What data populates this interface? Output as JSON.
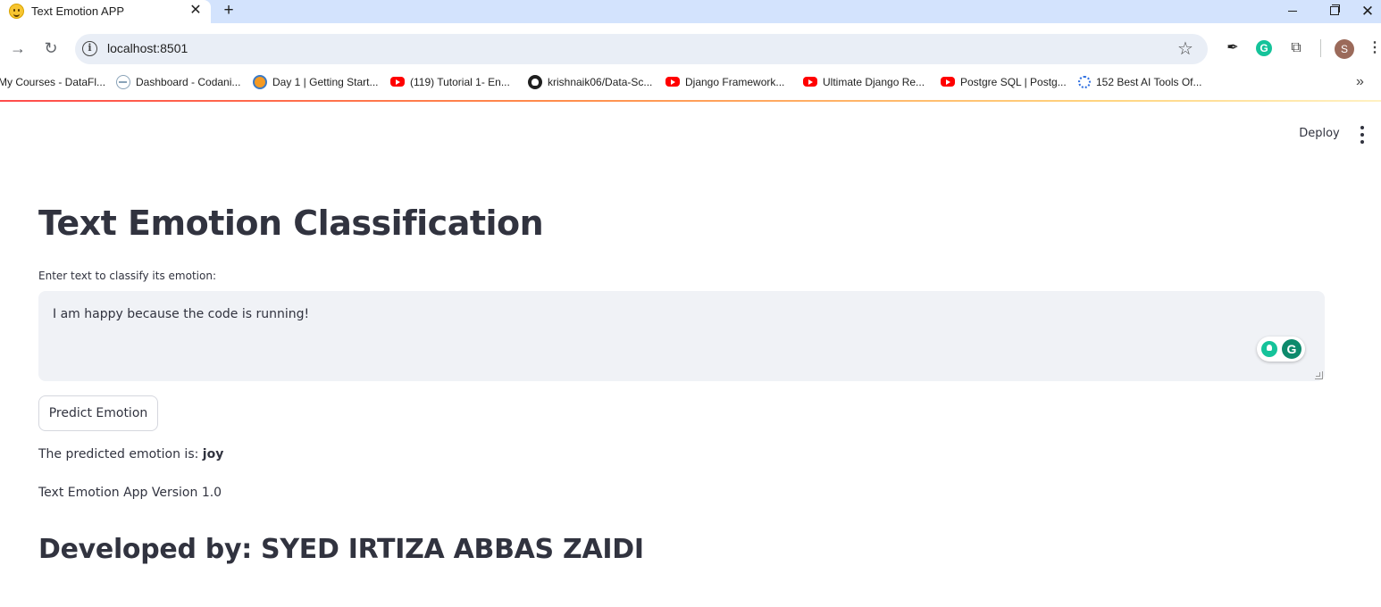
{
  "browser": {
    "tab_title": "Text Emotion APP",
    "tab_close": "✕",
    "new_tab": "+",
    "url": "localhost:8501",
    "bookmarks": [
      {
        "label": "My Courses - DataFl...",
        "icon": "none"
      },
      {
        "label": "Dashboard - Codani...",
        "icon": "codani-icon"
      },
      {
        "label": "Day 1 | Getting Start...",
        "icon": "orange-circle-icon"
      },
      {
        "label": "(119) Tutorial 1- En...",
        "icon": "youtube-icon"
      },
      {
        "label": "krishnaik06/Data-Sc...",
        "icon": "github-icon"
      },
      {
        "label": "Django Framework...",
        "icon": "youtube-icon"
      },
      {
        "label": "Ultimate Django Re...",
        "icon": "youtube-icon"
      },
      {
        "label": "Postgre SQL | Postg...",
        "icon": "youtube-icon"
      },
      {
        "label": "152 Best AI Tools Of...",
        "icon": "gear-icon"
      }
    ],
    "profile_initial": "S",
    "grammarly_letter": "G"
  },
  "app": {
    "deploy_label": "Deploy",
    "title": "Text Emotion Classification",
    "input_label": "Enter text to classify its emotion:",
    "input_value": "I am happy because the code is running!",
    "predict_button": "Predict Emotion",
    "result_prefix": "The predicted emotion is: ",
    "result_value": "joy",
    "version": "Text Emotion App Version 1.0",
    "developer": "Developed by: SYED IRTIZA ABBAS ZAIDI"
  },
  "colors": {
    "text": "#31333f",
    "textarea_bg": "#f0f2f6",
    "tabbar_bg": "#d3e3fd",
    "accent_red": "#ff4b4b"
  }
}
